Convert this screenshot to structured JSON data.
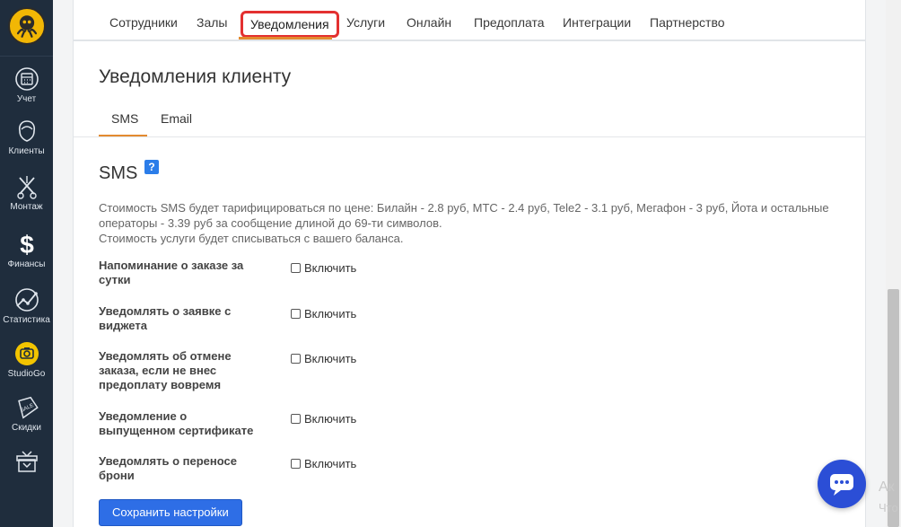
{
  "sidebar": {
    "items": [
      {
        "label": "Учет",
        "icon": "calendar-icon"
      },
      {
        "label": "Клиенты",
        "icon": "client-head-icon"
      },
      {
        "label": "Монтаж",
        "icon": "scissors-icon"
      },
      {
        "label": "Финансы",
        "icon": "dollar-icon"
      },
      {
        "label": "Статистика",
        "icon": "stats-icon"
      },
      {
        "label": "StudioGo",
        "icon": "camera-icon"
      },
      {
        "label": "Скидки",
        "icon": "sale-tag-icon"
      },
      {
        "label": "",
        "icon": "gift-box-icon"
      }
    ]
  },
  "top_tabs": [
    {
      "label": "Сотрудники"
    },
    {
      "label": "Залы"
    },
    {
      "label": "Уведомления",
      "active": true
    },
    {
      "label": "Услуги"
    },
    {
      "label": "Онлайн"
    },
    {
      "label": "Предоплата"
    },
    {
      "label": "Интеграции"
    },
    {
      "label": "Партнерство"
    }
  ],
  "panel": {
    "title": "Уведомления клиенту",
    "subtabs": [
      {
        "label": "SMS",
        "active": true
      },
      {
        "label": "Email"
      }
    ],
    "sms_heading": "SMS",
    "help_badge": "?",
    "description": [
      "Стоимость SMS будет тарифицироваться по цене: Билайн - 2.8 руб, МТС - 2.4 руб, Tele2 - 3.1 руб, Мегафон - 3 руб, Йота и остальные",
      "операторы - 3.39 руб за сообщение длиной до 69-ти символов.",
      "Стоимость услуги будет списываться с вашего баланса."
    ],
    "settings": [
      {
        "label": "Напоминание о заказе за сутки",
        "checkbox_label": "Включить",
        "checked": false
      },
      {
        "label": "Уведомлять о заявке с виджета",
        "checkbox_label": "Включить",
        "checked": false
      },
      {
        "label": "Уведомлять об отмене заказа, если не внес предоплату вовремя",
        "checkbox_label": "Включить",
        "checked": false
      },
      {
        "label": "Уведомление о выпущенном сертификате",
        "checkbox_label": "Включить",
        "checked": false
      },
      {
        "label": "Уведомлять о переносе брони",
        "checkbox_label": "Включить",
        "checked": false
      }
    ],
    "save_label": "Сохранить настройки"
  },
  "watermark": {
    "line1": "Ак",
    "line2": "Что"
  },
  "colors": {
    "sidebar_bg": "#1f2d3d",
    "accent_orange": "#e38a2f",
    "highlight_red": "#e33030",
    "primary_blue": "#2e6ee6",
    "chat_blue": "#2b4ed6"
  }
}
